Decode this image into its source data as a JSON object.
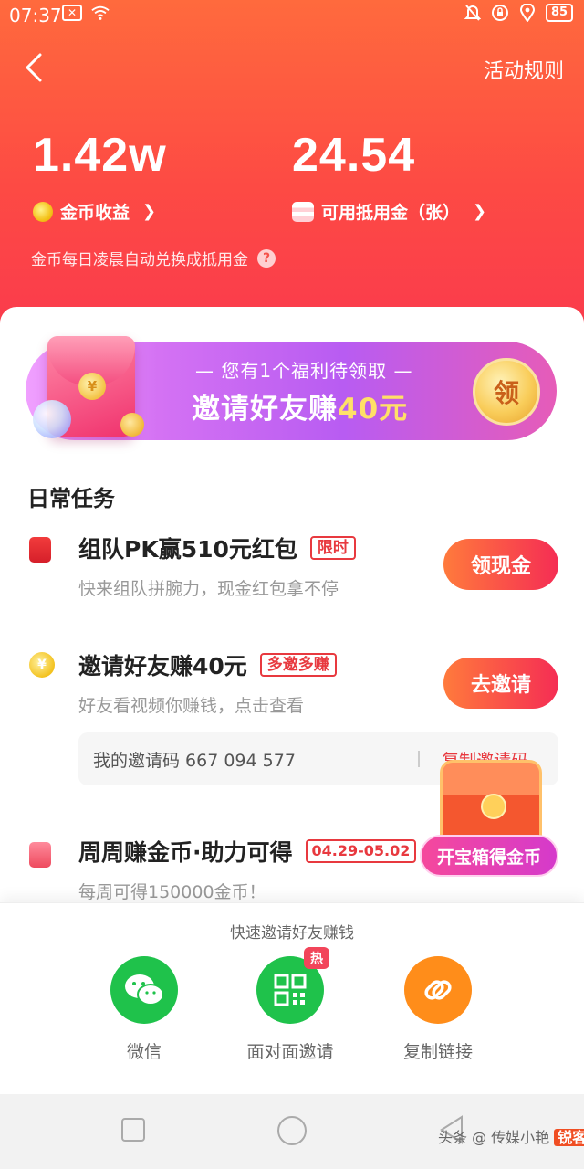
{
  "status": {
    "time": "07:37",
    "battery": "85"
  },
  "header": {
    "rules_label": "活动规则",
    "coins_value": "1.42w",
    "coins_label": "金币收益",
    "voucher_value": "24.54",
    "voucher_label": "可用抵用金（张）",
    "hint": "金币每日凌晨自动兑换成抵用金"
  },
  "banner": {
    "top_text": "— 您有1个福利待领取 —",
    "main_text": "邀请好友赚",
    "main_amount": "40元",
    "claim_label": "领",
    "envelope_coin": "¥",
    "active_dot": 1,
    "dots": 4
  },
  "section_title": "日常任务",
  "tasks": [
    {
      "title": "组队PK赢510元红包",
      "tag": "限时",
      "desc": "快来组队拼腕力，现金红包拿不停",
      "button": "领现金"
    },
    {
      "title": "邀请好友赚40元",
      "tag": "多邀多赚",
      "desc": "好友看视频你赚钱，点击查看",
      "button": "去邀请",
      "coin_symbol": "¥"
    },
    {
      "title": "周周赚金币·助力可得",
      "tag": "04.29-05.02",
      "desc": "每周可得150000金币！"
    }
  ],
  "invite_code": {
    "label": "我的邀请码 667 094 577",
    "copy_label": "复制邀请码"
  },
  "treasure": {
    "label": "开宝箱得金币"
  },
  "share": {
    "title": "快速邀请好友赚钱",
    "items": [
      {
        "label": "微信",
        "color": "#1fc24b"
      },
      {
        "label": "面对面邀请",
        "color": "#1fc24b",
        "badge": "热"
      },
      {
        "label": "复制链接",
        "color": "#ff8d1a"
      }
    ]
  },
  "watermark": {
    "logo": "锐客网",
    "text": "头条 @ 传媒小艳"
  },
  "colors": {
    "header_top": "#ff6a3d",
    "header_bottom": "#fa3a4d",
    "accent": "#e8393f"
  }
}
